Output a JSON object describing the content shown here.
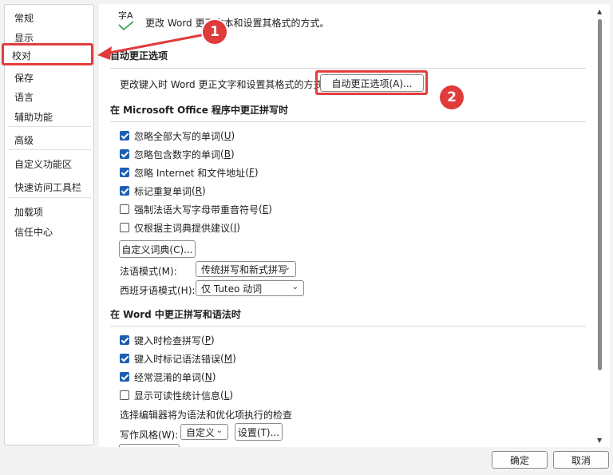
{
  "sidebar": {
    "items": [
      "常规",
      "显示",
      "校对",
      "保存",
      "语言",
      "辅助功能",
      "高级",
      "自定义功能区",
      "快速访问工具栏",
      "加载项",
      "信任中心"
    ],
    "selected": "校对"
  },
  "header": {
    "icon": "abc-check-icon",
    "icon_text": "字A",
    "text": "更改 Word 更正文本和设置其格式的方式。"
  },
  "autocorrect": {
    "title": "自动更正选项",
    "desc": "更改键入时 Word 更正文字和设置其格式的方式:",
    "button": "自动更正选项(A)...",
    "button_hotkey": "A"
  },
  "office_spelling": {
    "title": "在 Microsoft Office 程序中更正拼写时",
    "checks": [
      {
        "label": "忽略全部大写的单词",
        "key": "U",
        "checked": true
      },
      {
        "label": "忽略包含数字的单词",
        "key": "B",
        "checked": true
      },
      {
        "label": "忽略 Internet 和文件地址",
        "key": "F",
        "checked": true
      },
      {
        "label": "标记重复单词",
        "key": "R",
        "checked": true
      },
      {
        "label": "强制法语大写字母带重音符号",
        "key": "E",
        "checked": false
      },
      {
        "label": "仅根据主词典提供建议",
        "key": "I",
        "checked": false
      }
    ],
    "custom_dict_button": "自定义词典(C)...",
    "french_label": "法语模式(M):",
    "french_value": "传统拼写和新式拼写",
    "spanish_label": "西班牙语模式(H):",
    "spanish_value": "仅 Tuteo 动词"
  },
  "word_spelling": {
    "title": "在 Word 中更正拼写和语法时",
    "checks": [
      {
        "label": "键入时检查拼写",
        "key": "P",
        "checked": true
      },
      {
        "label": "键入时标记语法错误",
        "key": "M",
        "checked": true
      },
      {
        "label": "经常混淆的单词",
        "key": "N",
        "checked": true
      },
      {
        "label": "显示可读性统计信息",
        "key": "L",
        "checked": false
      }
    ],
    "editor_desc": "选择编辑器将为语法和优化项执行的检查",
    "style_label": "写作风格(W):",
    "style_value": "自定义",
    "settings_button": "设置(T)..."
  },
  "footer": {
    "ok": "确定",
    "cancel": "取消"
  },
  "callouts": {
    "one": "1",
    "two": "2"
  },
  "colors": {
    "accent": "#1a5fb4",
    "callout_red": "#e03b3b"
  }
}
